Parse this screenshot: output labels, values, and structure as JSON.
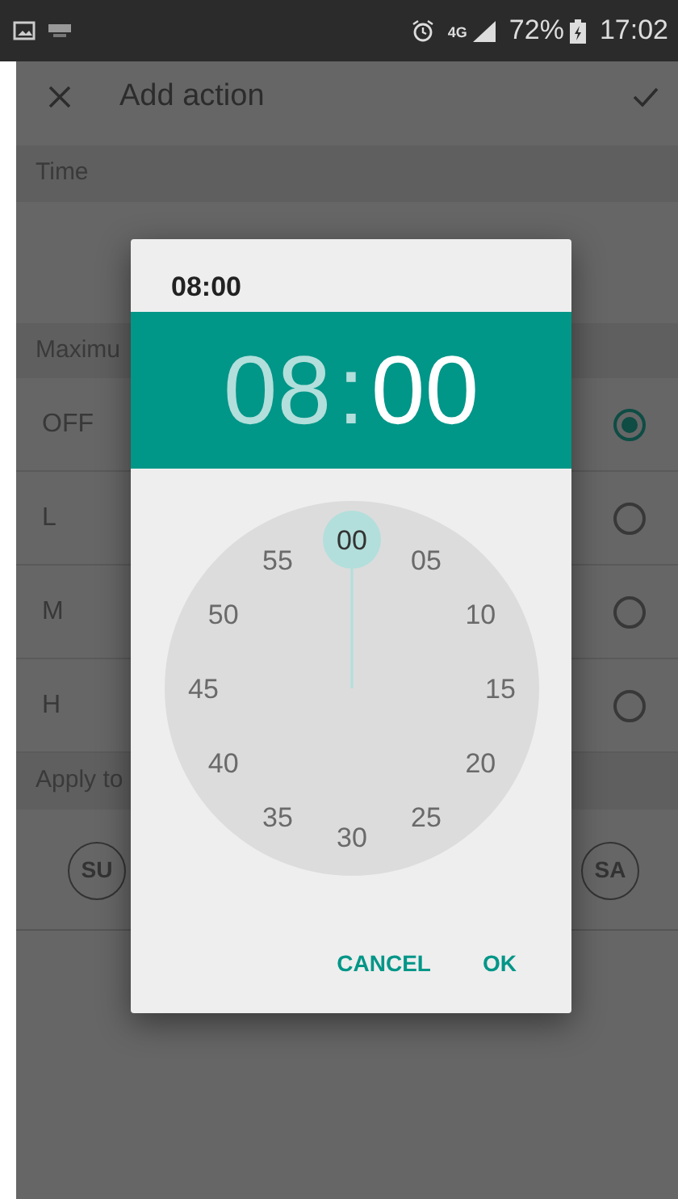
{
  "status_bar": {
    "network": "4G",
    "battery": "72%",
    "time": "17:02"
  },
  "toolbar": {
    "title": "Add action"
  },
  "form": {
    "time_header": "Time",
    "max_header": "Maximu",
    "levels": [
      {
        "label": "OFF",
        "selected": true
      },
      {
        "label": "L",
        "selected": false
      },
      {
        "label": "M",
        "selected": false
      },
      {
        "label": "H",
        "selected": false
      }
    ],
    "apply_header": "Apply to",
    "days": [
      {
        "label": "SU"
      },
      {
        "label": "SA"
      }
    ]
  },
  "dialog": {
    "header_time": "08:00",
    "hour": {
      "text": "08",
      "selected": false
    },
    "separator": ":",
    "minute": {
      "text": "00",
      "selected": true
    },
    "dial": [
      {
        "label": "00",
        "selected": true
      },
      {
        "label": "05",
        "selected": false
      },
      {
        "label": "10",
        "selected": false
      },
      {
        "label": "15",
        "selected": false
      },
      {
        "label": "20",
        "selected": false
      },
      {
        "label": "25",
        "selected": false
      },
      {
        "label": "30",
        "selected": false
      },
      {
        "label": "35",
        "selected": false
      },
      {
        "label": "40",
        "selected": false
      },
      {
        "label": "45",
        "selected": false
      },
      {
        "label": "50",
        "selected": false
      },
      {
        "label": "55",
        "selected": false
      }
    ],
    "buttons": [
      "CANCEL",
      "OK"
    ]
  }
}
